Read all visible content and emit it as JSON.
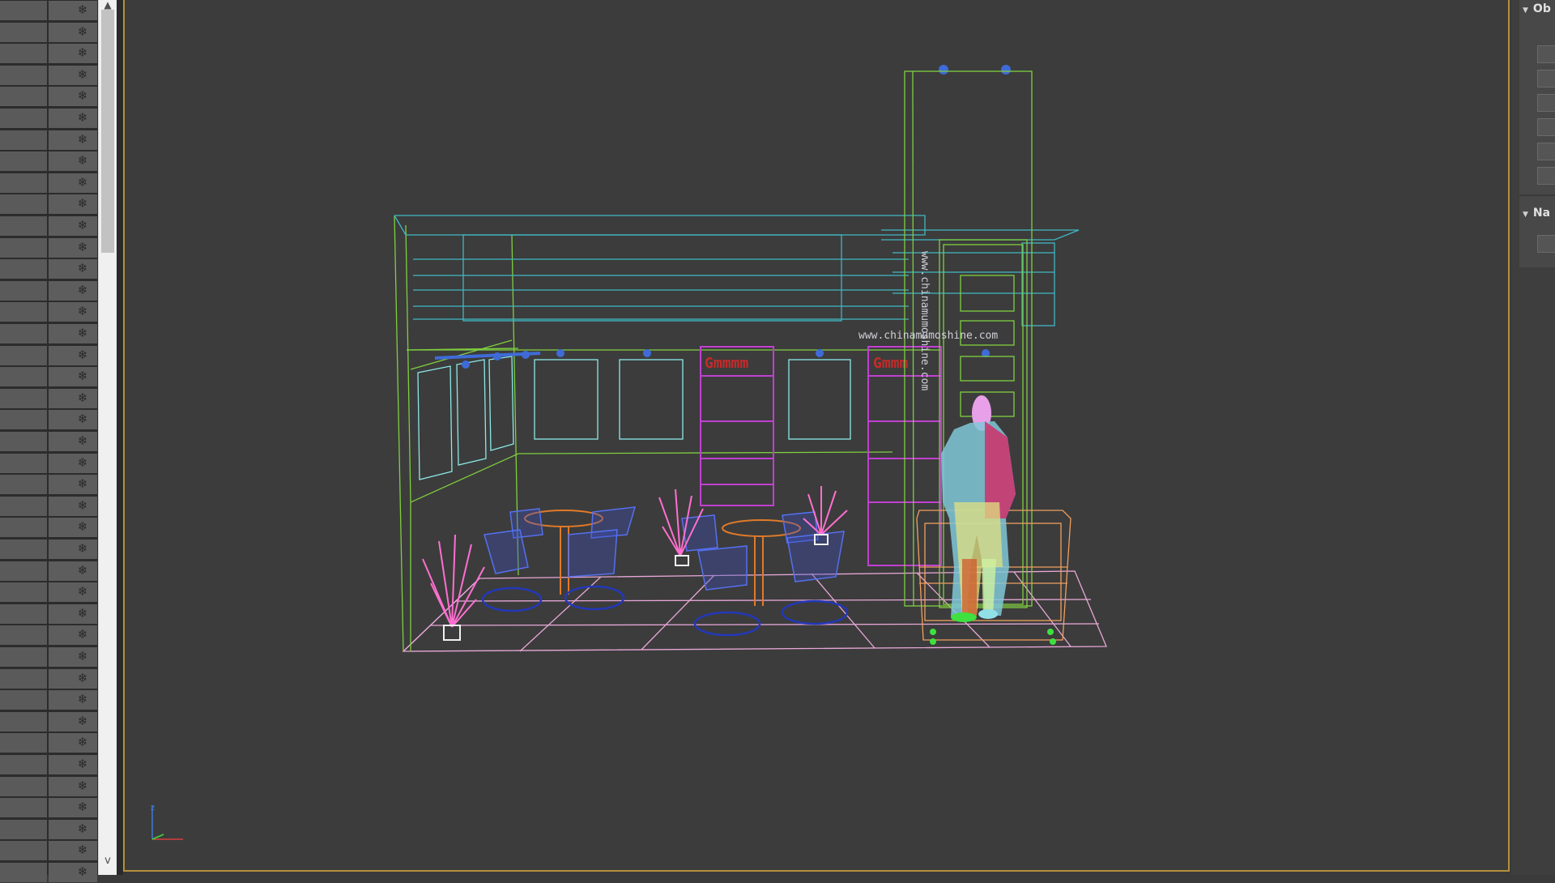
{
  "scene_explorer": {
    "freeze_icon": "snowflake-freeze-icon",
    "row_count": 41
  },
  "scrollbar": {
    "up_arrow": "▲",
    "down_arrow": "v"
  },
  "viewport": {
    "booth_url_text": "www.chinamumoshine.com",
    "vertical_banner_text": "www.chinamumoshine.com",
    "sign_text_1": "Gmmmm",
    "sign_text_2": "Gmmm",
    "axis_z_label": "z"
  },
  "command_panel": {
    "rollout_1_title": "Ob",
    "rollout_2_title": "Na",
    "rollout_toggle_glyph": "▼"
  },
  "colors": {
    "viewport_bg": "#3c3c3c",
    "viewport_border": "#b3913d",
    "wire_teal": "#3fb8c4",
    "wire_green": "#7fcf3f",
    "wire_magenta": "#c040d0",
    "wire_blue": "#4b5fe0",
    "wire_pink": "#ff6fd0",
    "wire_orange": "#e07a2a",
    "wire_floor": "#e8a8d8"
  }
}
